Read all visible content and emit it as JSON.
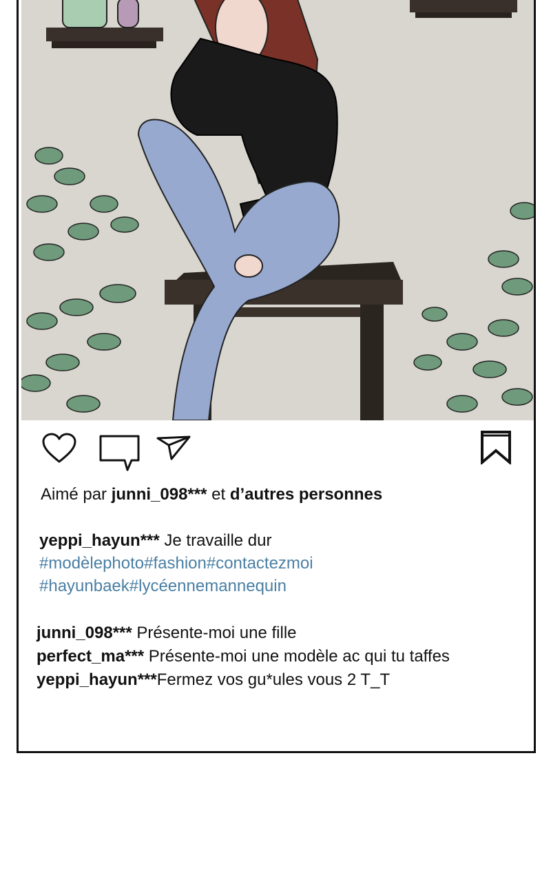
{
  "post": {
    "likes": {
      "prefix": "Aimé par",
      "user": "junni_098***",
      "conjunction": "et",
      "others": "d’autres personnes"
    },
    "caption": {
      "user": "yeppi_hayun***",
      "text": "Je travaille dur",
      "hashtags_line1": "#modèlephoto#fashion#contactezmoi",
      "hashtags_line2": "#hayunbaek#lycéennemannequin"
    },
    "comments": [
      {
        "user": "junni_098***",
        "text": "Présente-moi une fille"
      },
      {
        "user": "perfect_ma***",
        "text": "Présente-moi une modèle ac qui tu taffes"
      },
      {
        "user": "yeppi_hayun***",
        "text": "Fermez vos gu*ules vous 2 T_T"
      }
    ]
  },
  "icons": {
    "like": "heart-icon",
    "comment": "comment-bubble-icon",
    "share": "paper-plane-icon",
    "save": "bookmark-icon"
  },
  "colors": {
    "hashtag": "#4a7fa3",
    "text": "#111111",
    "frame_border": "#111111",
    "wall": "#d8d6cf",
    "leaf": "#6f9a7b"
  }
}
